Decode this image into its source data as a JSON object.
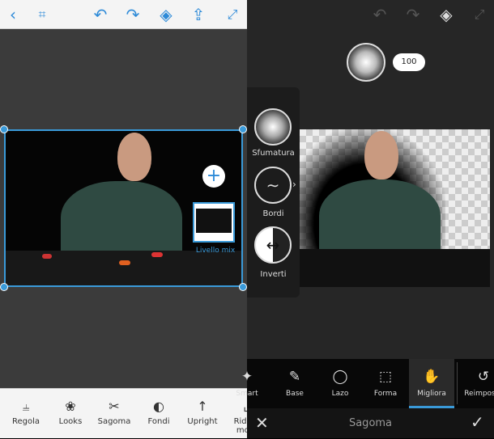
{
  "left": {
    "toolbar": {
      "icons": [
        "back-icon",
        "crop-icon",
        "undo-icon",
        "redo-icon",
        "layers-icon",
        "share-icon",
        "expand-icon"
      ]
    },
    "plus_label": "+",
    "layer_label": "Livello mix",
    "bottom_tools": [
      {
        "label": "Regola",
        "icon": "sliders-icon",
        "glyph": "⫨"
      },
      {
        "label": "Looks",
        "icon": "looks-icon",
        "glyph": "❀"
      },
      {
        "label": "Sagoma",
        "icon": "scissors-icon",
        "glyph": "✂"
      },
      {
        "label": "Fondi",
        "icon": "blend-icon",
        "glyph": "◐"
      },
      {
        "label": "Upright",
        "icon": "upright-icon",
        "glyph": "↑"
      },
      {
        "label": "Riduz. mov.",
        "icon": "shake-reduction-icon",
        "glyph": "⌞"
      }
    ]
  },
  "right": {
    "brush_size": "100",
    "side_options": [
      {
        "label": "Sfumatura"
      },
      {
        "label": "Bordi"
      },
      {
        "label": "Inverti"
      }
    ],
    "tools": [
      {
        "label": "Smart",
        "glyph": "✦"
      },
      {
        "label": "Base",
        "glyph": "✎"
      },
      {
        "label": "Lazo",
        "glyph": "◯"
      },
      {
        "label": "Forma",
        "glyph": "⬚"
      },
      {
        "label": "Migliora",
        "glyph": "✋"
      },
      {
        "label": "Reimposta",
        "glyph": "↺"
      }
    ],
    "active_tool": "Migliora",
    "footer_title": "Sagoma",
    "accent": "#3a9ad9"
  }
}
